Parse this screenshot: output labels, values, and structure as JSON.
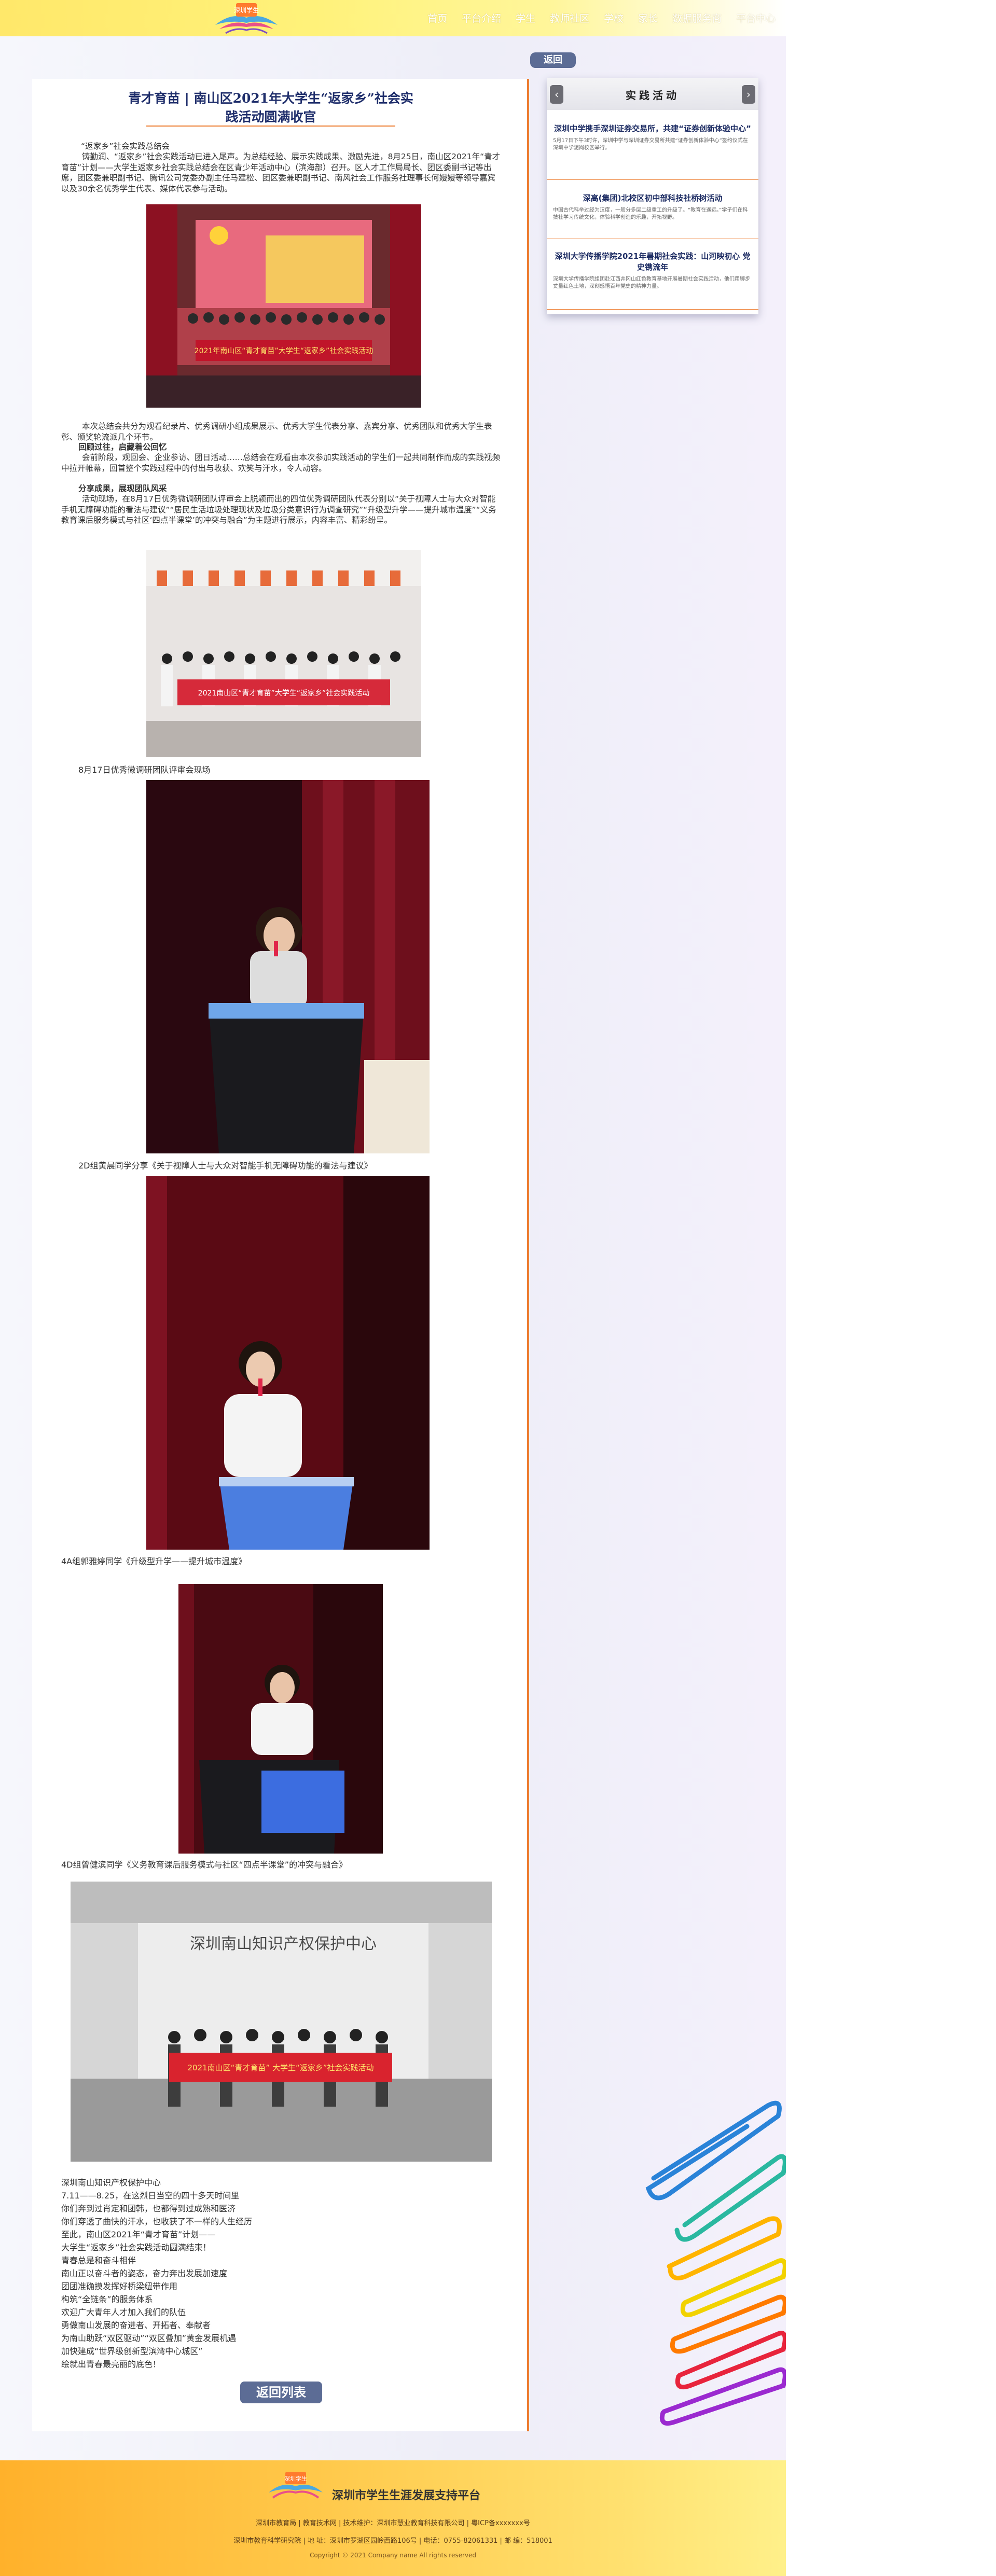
{
  "header": {
    "logo_text": "深圳学生",
    "nav": [
      "首页",
      "平台介绍",
      "学生",
      "教师社区",
      "学校",
      "家长",
      "数据服务商",
      "平台中心"
    ]
  },
  "back_label": "返回",
  "article": {
    "title_line1": "青才育苗 | 南山区2021年大学生“返家乡”社会实",
    "title_line2": "践活动圆满收官",
    "p1": "“返家乡”社会实践总结会",
    "p2": "铸勤润、“返家乡”社会实践活动已进入尾声。为总结经验、展示实践成果、激励先进，8月25日，南山区2021年“青才育苗”计划——大学生返家乡社会实践总结会在区青少年活动中心（滨海部）召开。区人才工作局局长、团区委副书记等出席，团区委兼职副书记、腾讯公司党委办副主任马建松、团区委兼职副书记、南风社会工作服务社理事长何嫚嫚等领导嘉宾以及30余名优秀学生代表、媒体代表参与活动。",
    "p3": "本次总结会共分为观看纪录片、优秀调研小组成果展示、优秀大学生代表分享、嘉宾分享、优秀团队和优秀大学生表彰、颁奖轮流派几个环节。",
    "s1": "回顾过往，启藏着公回忆",
    "p4": "会前阶段，观回会、企业参访、团日活动……总结会在观看由本次参加实践活动的学生们一起共同制作而成的实践视频中拉开帷幕，回首整个实践过程中的付出与收获、欢笑与汗水，令人动容。",
    "s2": "分享成果，展现团队风采",
    "p5": "活动现场，在8月17日优秀微调研团队评审会上脱颖而出的四位优秀调研团队代表分别以“关于视障人士与大众对智能手机无障碍功能的看法与建议”“居民生活垃圾处理现状及垃圾分类意识行为调查研究”“升级型升学——提升城市温度”“义务教育课后服务模式与社区‘四点半课堂’的冲突与融合”为主题进行展示，内容丰富、精彩纷呈。",
    "cap1": "8月17日优秀微调研团队评审会现场",
    "cap2": "2D组黄晨同学分享《关于视障人士与大众对智能手机无障碍功能的看法与建议》",
    "cap3": "4A组郭雅婷同学《升级型升学——提升城市温度》",
    "cap4": "4D组曾健滨同学《义务教育课后服务模式与社区“四点半课堂”的冲突与融合》",
    "banner1": "2021年南山区“青才育苗”大学生“返家乡”社会实践活动",
    "banner2": "2021南山区“青才育苗”大学生“返家乡”社会实践活动",
    "banner3": "2021南山区“青才育苗” 大学生“返家乡”社会实践活动",
    "wall_text": "深圳南山知识产权保护中心",
    "poem": [
      "深圳南山知识产权保护中心",
      "7.11——8.25，在这烈日当空的四十多天时间里",
      "你们奔到过肖定和团韩，也都得到过成熟和医济",
      "你们穿透了曲快的汗水，也收获了不一样的人生经历",
      "至此，南山区2021年“青才育苗”计划——",
      "大学生“返家乡”社会实践活动圆满结束！",
      "青春总是和奋斗相伴",
      "南山正以奋斗者的姿态，奋力奔出发展加速度",
      "团团准确摸发挥好桥梁纽带作用",
      "构筑“全链条”的服务体系",
      "欢迎广大青年人才加入我们的队伍",
      "勇做南山发展的奋进者、开拓者、奉献者",
      "为南山助跃“双区驱动”“双区叠加”黄金发展机遇",
      "加快建成“世界级创新型滨湾中心城区”",
      "绘就出青春最亮丽的底色！"
    ]
  },
  "back_list_label": "返回列表",
  "sidebar": {
    "title": "实践活动",
    "prev_icon": "‹",
    "next_icon": "›",
    "items": [
      {
        "title": "深圳中学携手深圳证券交易所，共建“证券创新体验中心”",
        "desc": "5月17日下午3时许，深圳中学与深圳证券交易所共建“证券创新体验中心”签约仪式在深圳中学泥岗校区举行。"
      },
      {
        "title": "深高(集团)北校区初中部科技社桥树活动",
        "desc": "中国古代科举过经为汉度，一般分多层二级重工的升级了。“教育在遥远。”学子们在科技社学习传统文化，体验科学创造的乐趣，开拓视野。"
      },
      {
        "title": "深圳大学传播学院2021年暑期社会实践：山河映初心 党史镌流年",
        "desc": "深圳大学传播学院组团赴江西井冈山红色教育基地开展暑期社会实践活动，他们用脚步丈量红色土地，深刻感悟百年党史的精神力量。"
      }
    ]
  },
  "footer": {
    "brand": "深圳市学生生涯发展支持平台",
    "logo_text": "深圳学生",
    "line1": "深圳市教育局  |  教育技术网  |  技术维护：深圳市慧业教育科技有限公司  |  粤ICP备xxxxxxx号",
    "line2": "深圳市教育科学研究院  |  地 址：深圳市罗湖区园岭西路106号  |  电话：0755-82061331  |  邮 编：518001",
    "copyright": "Copyright © 2021 Company name All rights reserved"
  },
  "colors": {
    "accent": "#ed7d31",
    "navy": "#1f2e6b",
    "button": "#5c6c95"
  }
}
